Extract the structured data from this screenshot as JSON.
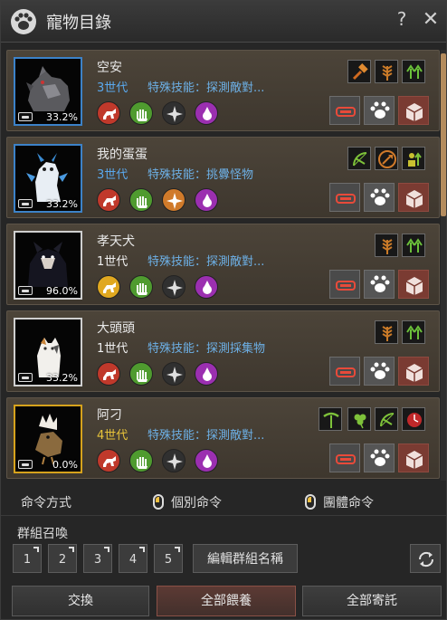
{
  "window": {
    "title": "寵物目錄",
    "logo_icon": "paw-icon",
    "help_label": "?",
    "close_label": "✕"
  },
  "pets": [
    {
      "name": "空安",
      "generation": "3世代",
      "gen_color": "blue",
      "skill": "特殊技能：探測敵對...",
      "percent": "33.2%",
      "portrait": "gray-armored-dog",
      "border": "blue",
      "traits": [
        "dog-run-red",
        "green-hand",
        "compass-gray",
        "purple-drop"
      ],
      "skills": [
        "hammer-icon",
        "wheat-icon",
        "arrow-up-icon"
      ]
    },
    {
      "name": "我的蛋蛋",
      "generation": "3世代",
      "gen_color": "blue",
      "skill": "特殊技能：挑釁怪物",
      "percent": "33.2%",
      "portrait": "white-dragon",
      "border": "blue",
      "traits": [
        "dog-run-red",
        "green-hand",
        "orange-compass",
        "purple-drop"
      ],
      "skills": [
        "bow-icon",
        "axe-icon",
        "person-up-icon"
      ]
    },
    {
      "name": "孝天犬",
      "generation": "1世代",
      "gen_color": "white",
      "skill": "特殊技能：探測敵對...",
      "percent": "96.0%",
      "portrait": "black-dog",
      "border": "white",
      "traits": [
        "yellow-dog",
        "green-hand",
        "compass-gray",
        "purple-drop"
      ],
      "skills": [
        "wheat-icon",
        "arrow-up-icon"
      ]
    },
    {
      "name": "大頭頭",
      "generation": "1世代",
      "gen_color": "white",
      "skill": "特殊技能：探測採集物",
      "percent": "33.2%",
      "portrait": "white-cat",
      "border": "white",
      "traits": [
        "dog-run-red",
        "green-hand",
        "compass-gray",
        "purple-drop"
      ],
      "skills": [
        "wheat-icon",
        "arrow-up-icon"
      ]
    },
    {
      "name": "阿刁",
      "generation": "4世代",
      "gen_color": "yellow",
      "skill": "特殊技能：探測敵對...",
      "percent": "0.0%",
      "portrait": "eggshell-bird",
      "border": "gold",
      "traits": [
        "dog-run-red",
        "green-hand",
        "compass-gray",
        "purple-drop"
      ],
      "skills": [
        "pickaxe-icon",
        "clover-icon",
        "bow-icon",
        "red-clock-icon"
      ]
    }
  ],
  "commands": {
    "label": "命令方式",
    "individual": "個別命令",
    "group": "團體命令"
  },
  "group_summon": {
    "label": "群組召喚",
    "slots": [
      "1",
      "2",
      "3",
      "4",
      "5"
    ],
    "rename": "編輯群組名稱"
  },
  "bottom": {
    "swap": "交換",
    "feed_all": "全部餵養",
    "deposit_all": "全部寄託"
  },
  "colors": {
    "accent_blue": "#5aa9ee",
    "gen_yellow": "#e8c43a",
    "card_bg": "#463f35",
    "scroll_thumb": "#b48c5e"
  }
}
